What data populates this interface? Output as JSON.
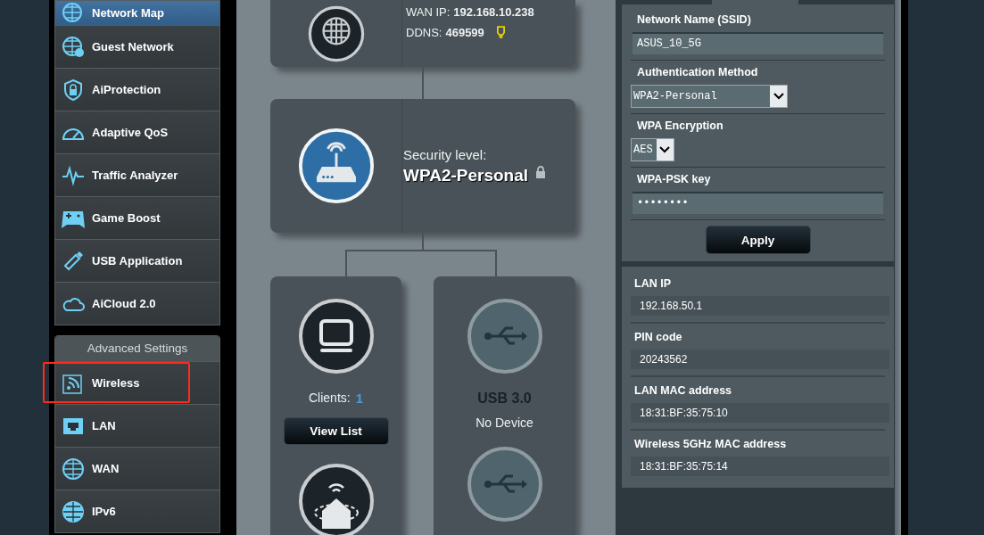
{
  "sidebar": {
    "items": [
      {
        "label": "Network Map",
        "selected": true,
        "highlighted": false
      },
      {
        "label": "Guest Network",
        "selected": false,
        "highlighted": false
      },
      {
        "label": "AiProtection",
        "selected": false,
        "highlighted": false
      },
      {
        "label": "Adaptive QoS",
        "selected": false,
        "highlighted": false
      },
      {
        "label": "Traffic Analyzer",
        "selected": false,
        "highlighted": false
      },
      {
        "label": "Game Boost",
        "selected": false,
        "highlighted": false
      },
      {
        "label": "USB Application",
        "selected": false,
        "highlighted": false
      },
      {
        "label": "AiCloud 2.0",
        "selected": false,
        "highlighted": false
      }
    ],
    "section_title": "Advanced Settings",
    "advanced_items": [
      {
        "label": "Wireless",
        "selected": false,
        "highlighted": true
      },
      {
        "label": "LAN",
        "selected": false,
        "highlighted": false
      },
      {
        "label": "WAN",
        "selected": false,
        "highlighted": false
      },
      {
        "label": "IPv6",
        "selected": false,
        "highlighted": false
      }
    ]
  },
  "map": {
    "internet": {
      "wan_ip_label": "WAN IP:",
      "wan_ip": "192.168.10.238",
      "ddns_label": "DDNS:",
      "ddns": "469599"
    },
    "router": {
      "security_label": "Security level:",
      "security": "WPA2-Personal"
    },
    "clients": {
      "label": "Clients:",
      "count": "1",
      "button": "View List"
    },
    "usb": {
      "title": "USB 3.0",
      "status": "No Device"
    }
  },
  "wireless_form": {
    "fields": [
      {
        "kind": "text",
        "label": "Network Name (SSID)",
        "value": "ASUS_10_5G"
      },
      {
        "kind": "select",
        "label": "Authentication Method",
        "value": "WPA2-Personal"
      },
      {
        "kind": "select",
        "label": "WPA Encryption",
        "value": "AES"
      },
      {
        "kind": "password",
        "label": "WPA-PSK key",
        "value": "••••••••"
      }
    ],
    "button": "Apply"
  },
  "info": [
    {
      "label": "LAN IP",
      "value": "192.168.50.1"
    },
    {
      "label": "PIN code",
      "value": "20243562"
    },
    {
      "label": "LAN MAC address",
      "value": "18:31:BF:35:75:10"
    },
    {
      "label": "Wireless 5GHz MAC address",
      "value": "18:31:BF:35:75:14"
    }
  ]
}
